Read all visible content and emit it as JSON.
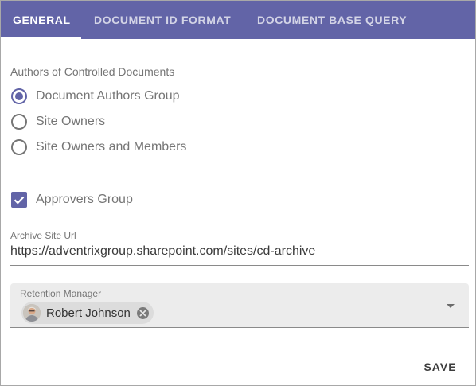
{
  "tabs": {
    "general": "GENERAL",
    "document_id_format": "DOCUMENT ID FORMAT",
    "document_base_query": "DOCUMENT BASE QUERY",
    "active": "GENERAL"
  },
  "authors": {
    "label": "Authors of Controlled Documents",
    "options": [
      {
        "label": "Document Authors Group",
        "selected": true
      },
      {
        "label": "Site Owners",
        "selected": false
      },
      {
        "label": "Site Owners and Members",
        "selected": false
      }
    ]
  },
  "approvers": {
    "label": "Approvers Group",
    "checked": true
  },
  "archive": {
    "label": "Archive Site Url",
    "value": "https://adventrixgroup.sharepoint.com/sites/cd-archive"
  },
  "retention": {
    "label": "Retention Manager",
    "person": "Robert Johnson"
  },
  "actions": {
    "save_label": "SAVE"
  },
  "colors": {
    "accent": "#6264a7",
    "tab_bar": "#6264a7"
  },
  "icons": {
    "checkbox": "check-icon",
    "chip_remove": "close-circle-icon",
    "dropdown": "caret-down-icon",
    "avatar": "user-avatar"
  }
}
